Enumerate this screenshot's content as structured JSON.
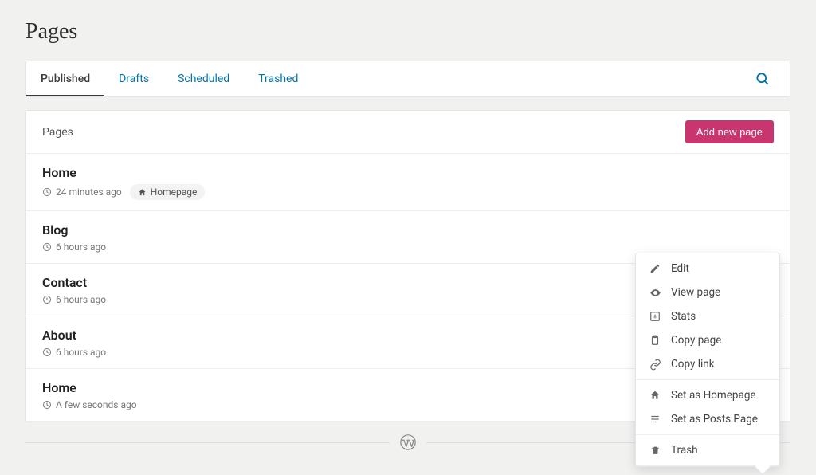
{
  "title": "Pages",
  "tabs": [
    {
      "label": "Published",
      "active": true
    },
    {
      "label": "Drafts",
      "active": false
    },
    {
      "label": "Scheduled",
      "active": false
    },
    {
      "label": "Trashed",
      "active": false
    }
  ],
  "list_header": "Pages",
  "add_button": "Add new page",
  "rows": [
    {
      "title": "Home",
      "time": "24 minutes ago",
      "badge": "Homepage"
    },
    {
      "title": "Blog",
      "time": "6 hours ago"
    },
    {
      "title": "Contact",
      "time": "6 hours ago"
    },
    {
      "title": "About",
      "time": "6 hours ago"
    },
    {
      "title": "Home",
      "time": "A few seconds ago"
    }
  ],
  "popover": {
    "edit": "Edit",
    "view": "View page",
    "stats": "Stats",
    "copy_page": "Copy page",
    "copy_link": "Copy link",
    "set_home": "Set as Homepage",
    "set_posts": "Set as Posts Page",
    "trash": "Trash"
  }
}
